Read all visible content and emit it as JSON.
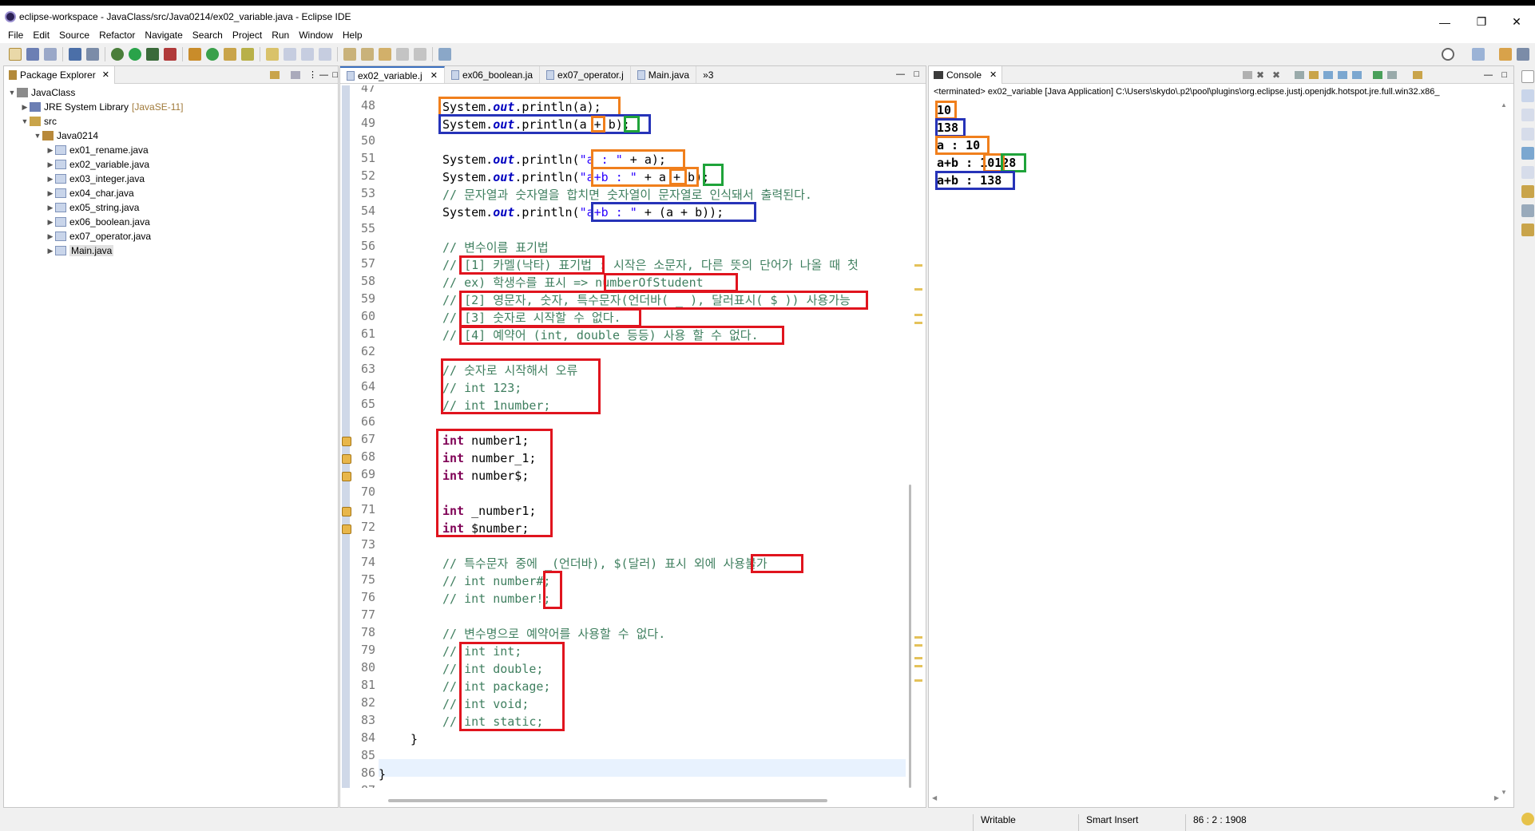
{
  "window": {
    "title": "eclipse-workspace - JavaClass/src/Java0214/ex02_variable.java - Eclipse IDE",
    "minimize": "—",
    "maximize": "❐",
    "close": "✕"
  },
  "menu": [
    "File",
    "Edit",
    "Source",
    "Refactor",
    "Navigate",
    "Search",
    "Project",
    "Run",
    "Window",
    "Help"
  ],
  "package_explorer": {
    "title": "Package Explorer",
    "project": "JavaClass",
    "jre": "JRE System Library",
    "jre_version": "[JavaSE-11]",
    "src": "src",
    "package": "Java0214",
    "files": [
      "ex01_rename.java",
      "ex02_variable.java",
      "ex03_integer.java",
      "ex04_char.java",
      "ex05_string.java",
      "ex06_boolean.java",
      "ex07_operator.java",
      "Main.java"
    ]
  },
  "editor": {
    "tabs": [
      "ex02_variable.j",
      "ex06_boolean.ja",
      "ex07_operator.j",
      "Main.java"
    ],
    "overflow": "»3",
    "line_numbers": [
      "47",
      "48",
      "49",
      "50",
      "51",
      "52",
      "53",
      "54",
      "55",
      "56",
      "57",
      "58",
      "59",
      "60",
      "61",
      "62",
      "63",
      "64",
      "65",
      "66",
      "67",
      "68",
      "69",
      "70",
      "71",
      "72",
      "73",
      "74",
      "75",
      "76",
      "77",
      "78",
      "79",
      "80",
      "81",
      "82",
      "83",
      "84",
      "85",
      "86",
      "87"
    ],
    "code": {
      "l48": {
        "a": "System.",
        "b": "out",
        "c": ".println(a);"
      },
      "l49": {
        "a": "System.",
        "b": "out",
        "c": ".println(a + b);"
      },
      "l51": {
        "a": "System.",
        "b": "out",
        "c": ".println(",
        "d": "\"a : \"",
        "e": " + a);"
      },
      "l52": {
        "a": "System.",
        "b": "out",
        "c": ".println(",
        "d": "\"a+b : \"",
        "e": " + a + b);"
      },
      "l53": "// 문자열과 숫자열을 합치면 숫자열이 문자열로 인식돼서 출력된다.",
      "l54": {
        "a": "System.",
        "b": "out",
        "c": ".println(",
        "d": "\"a+b : \"",
        "e": " + (a + b));"
      },
      "l56": "// 변수이름 표기법",
      "l57": "// [1] 카멜(낙타) 표기법 : 시작은 소문자, 다른 뜻의 단어가 나올 때 첫",
      "l58": "// ex) 학생수를 표시 => numberOfStudent",
      "l59": "// [2] 영문자, 숫자, 특수문자(언더바( _ ), 달러표시( $ )) 사용가능",
      "l60": "// [3] 숫자로 시작할 수 없다.",
      "l61": "// [4] 예약어 (int, double 등등) 사용 할 수 없다.",
      "l63": "// 숫자로 시작해서 오류",
      "l64": "// int 123;",
      "l65": "// int 1number;",
      "l67": {
        "kw": "int",
        "rest": " number1;"
      },
      "l68": {
        "kw": "int",
        "rest": " number_1;"
      },
      "l69": {
        "kw": "int",
        "rest": " number$;"
      },
      "l71": {
        "kw": "int",
        "rest": " _number1;"
      },
      "l72": {
        "kw": "int",
        "rest": " $number;"
      },
      "l74": "// 특수문자 중에 _(언더바), $(달러) 표시 외에 사용불가",
      "l75": "// int number#;",
      "l76": "// int number!;",
      "l78": "// 변수명으로 예약어를 사용할 수 없다.",
      "l79": "// int int;",
      "l80": "// int double;",
      "l81": "// int package;",
      "l82": "// int void;",
      "l83": "// int static;",
      "l84": "}",
      "l86": "}"
    }
  },
  "console": {
    "title": "Console",
    "info": "<terminated> ex02_variable [Java Application] C:\\Users\\skydo\\.p2\\pool\\plugins\\org.eclipse.justj.openjdk.hotspot.jre.full.win32.x86_",
    "output": [
      "10",
      "138",
      "a : 10",
      "a+b : 10128",
      "a+b : 138"
    ]
  },
  "status": {
    "writable": "Writable",
    "insert": "Smart Insert",
    "position": "86 : 2 : 1908"
  },
  "colors": {
    "orange_box": "#f07f1c",
    "blue_box": "#2633b8",
    "green_box": "#1fa33a",
    "red_box": "#e0141e"
  }
}
